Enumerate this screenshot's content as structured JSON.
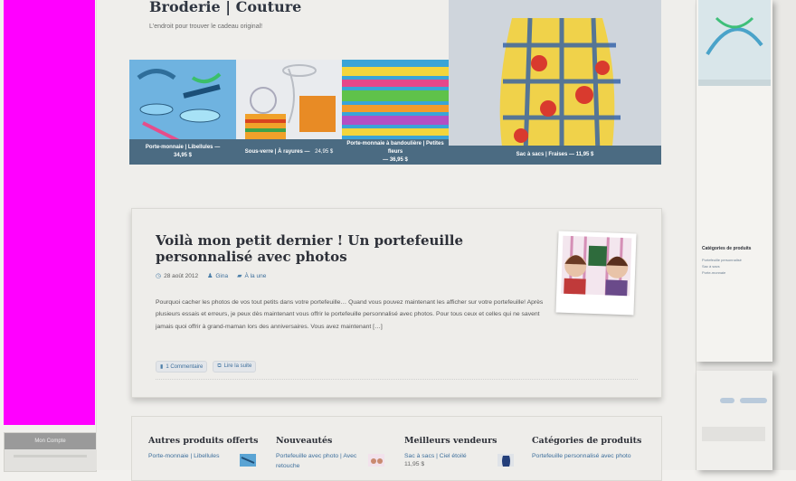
{
  "site": {
    "title": "Broderie | Couture",
    "tagline": "L'endroit pour trouver le cadeau original!"
  },
  "left_sidebar": {
    "account_label": "Mon Compte"
  },
  "hero": {
    "tiles": [
      {
        "name": "Porte-monnaie | Libellules",
        "sep": "—",
        "price": "34,95 $"
      },
      {
        "name": "Sous-verre | À rayures",
        "sep": "—",
        "price": "24,95 $"
      },
      {
        "name": "Porte-monnaie à bandoulière | Petites fleurs",
        "sep": "—",
        "price": "36,95 $"
      }
    ],
    "featured": {
      "name": "Sac à sacs | Fraises",
      "sep": "—",
      "price": "11,95 $"
    }
  },
  "post": {
    "title": "Voilà mon petit dernier ! Un portefeuille personnalisé avec photos",
    "date": "28 août 2012",
    "author": "Gina",
    "category": "À la une",
    "excerpt": "Pourquoi cacher les photos de vos tout petits dans votre portefeuille… Quand vous pouvez maintenant les afficher sur votre portefeuille! Après plusieurs essais et erreurs, je peux dès maintenant vous offrir le portefeuille personnalisé avec photos. Pour tous ceux et celles qui ne savent jamais quoi offrir à grand-maman lors des anniversaires. Vous avez maintenant […]",
    "comments_label": "1 Commentaire",
    "read_more_label": "Lire la suite"
  },
  "widgets": [
    {
      "title": "Autres produits offerts",
      "item": "Porte-monnaie | Libellules",
      "sub": ""
    },
    {
      "title": "Nouveautés",
      "item": "Portefeuille avec photo | Avec retouche",
      "sub": ""
    },
    {
      "title": "Meilleurs vendeurs",
      "item": "Sac à sacs | Ciel étoilé",
      "sub": "11,95 $"
    },
    {
      "title": "Catégories de produits",
      "item": "Portefeuille personnalisé avec photo",
      "sub": ""
    }
  ],
  "right_pane": {
    "categories_title": "Catégories de produits",
    "items": [
      "Portefeuille personnalisé",
      "Sac à sacs",
      "Porte-monnaie"
    ]
  },
  "colors": {
    "magenta": "#ff00ff",
    "caption_bar": "#4b6b82",
    "link": "#3d6f9c",
    "heading": "#2d3038"
  }
}
